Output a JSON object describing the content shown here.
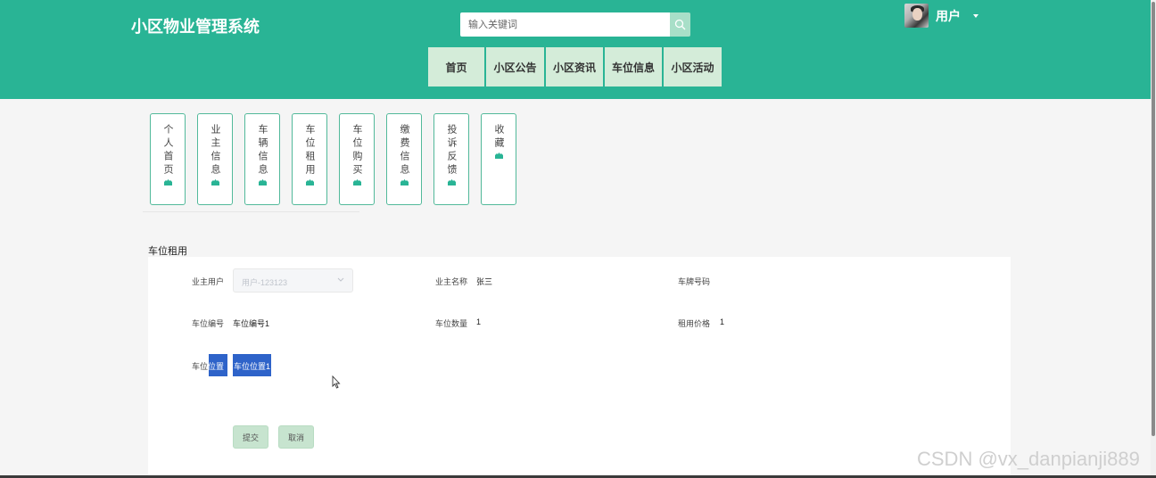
{
  "header": {
    "site_title": "小区物业管理系统",
    "search": {
      "placeholder": "输入关键词",
      "icon": "search-icon"
    },
    "user": {
      "name": "用户",
      "avatar": "avatar-photo"
    },
    "nav": [
      {
        "label": "首页"
      },
      {
        "label": "小区公告"
      },
      {
        "label": "小区资讯"
      },
      {
        "label": "车位信息"
      },
      {
        "label": "小区活动"
      }
    ]
  },
  "side_menu": [
    {
      "label": "个人首页",
      "icon": "home-icon"
    },
    {
      "label": "业主信息",
      "icon": "home-icon"
    },
    {
      "label": "车辆信息",
      "icon": "home-icon"
    },
    {
      "label": "车位租用",
      "icon": "home-icon"
    },
    {
      "label": "车位购买",
      "icon": "home-icon"
    },
    {
      "label": "缴费信息",
      "icon": "home-icon"
    },
    {
      "label": "投诉反馈",
      "icon": "home-icon"
    },
    {
      "label": "收藏",
      "icon": "home-icon"
    }
  ],
  "form": {
    "title": "车位租用",
    "owner_user": {
      "label": "业主用户",
      "value": "用户-123123"
    },
    "owner_name": {
      "label": "业主名称",
      "value": "张三"
    },
    "plate_number": {
      "label": "车牌号码",
      "value": ""
    },
    "space_number": {
      "label": "车位编号",
      "value": "车位编号1"
    },
    "space_count": {
      "label": "车位数量",
      "value": "1"
    },
    "rent_price": {
      "label": "租用价格",
      "value": "1"
    },
    "space_location": {
      "label_a": "车位",
      "label_b": "位置",
      "value": "车位位置1"
    },
    "submit_label": "提交",
    "cancel_label": "取消"
  },
  "watermark": "CSDN @vx_danpianji889",
  "colors": {
    "primary": "#29b495",
    "nav_bg": "#d4ecd9",
    "button_bg": "#c7e4cf",
    "highlight": "#2e63c9"
  }
}
